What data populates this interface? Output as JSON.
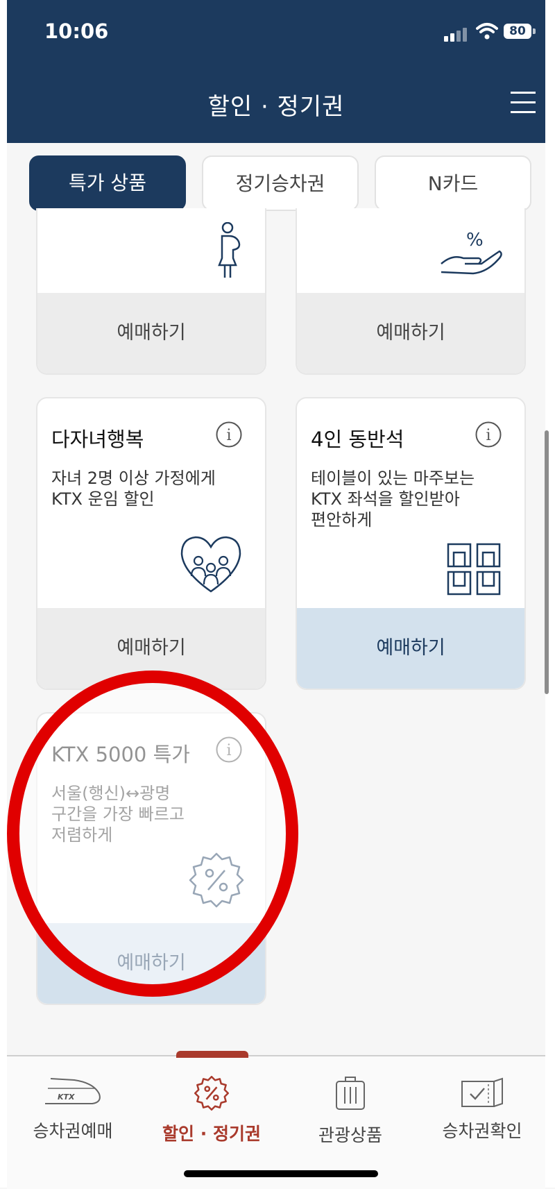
{
  "status_bar": {
    "time": "10:06",
    "battery": "80"
  },
  "header": {
    "title": "할인 · 정기권"
  },
  "tabs": [
    {
      "label": "특가 상품",
      "active": true
    },
    {
      "label": "정기승차권",
      "active": false
    },
    {
      "label": "N카드",
      "active": false
    }
  ],
  "cards": [
    {
      "button": "예매하기",
      "icon": "pregnant-woman-icon"
    },
    {
      "button": "예매하기",
      "icon": "discount-hand-icon"
    },
    {
      "title": "다자녀행복",
      "desc": "자녀 2명 이상 가정에게\nKTX 운임 할인",
      "button": "예매하기",
      "icon": "family-heart-icon"
    },
    {
      "title": "4인 동반석",
      "desc": "테이블이 있는 마주보는\nKTX 좌석을 할인받아\n편안하게",
      "button": "예매하기",
      "icon": "facing-seats-icon"
    },
    {
      "title": "KTX 5000 특가",
      "desc": "서울(행신)↔광명\n구간을 가장 빠르고\n저렴하게",
      "button": "예매하기",
      "icon": "discount-badge-icon"
    }
  ],
  "bottom_nav": [
    {
      "label": "승차권예매",
      "icon": "ktx-train-icon",
      "active": false
    },
    {
      "label": "할인 · 정기권",
      "icon": "discount-badge-icon",
      "active": true
    },
    {
      "label": "관광상품",
      "icon": "suitcase-icon",
      "active": false
    },
    {
      "label": "승차권확인",
      "icon": "ticket-check-icon",
      "active": false
    }
  ],
  "colors": {
    "primary": "#1c3a5e",
    "accent": "#a93a2c",
    "highlight": "#e00000",
    "button_blue": "#d3e1ed",
    "button_gray": "#ececec"
  }
}
